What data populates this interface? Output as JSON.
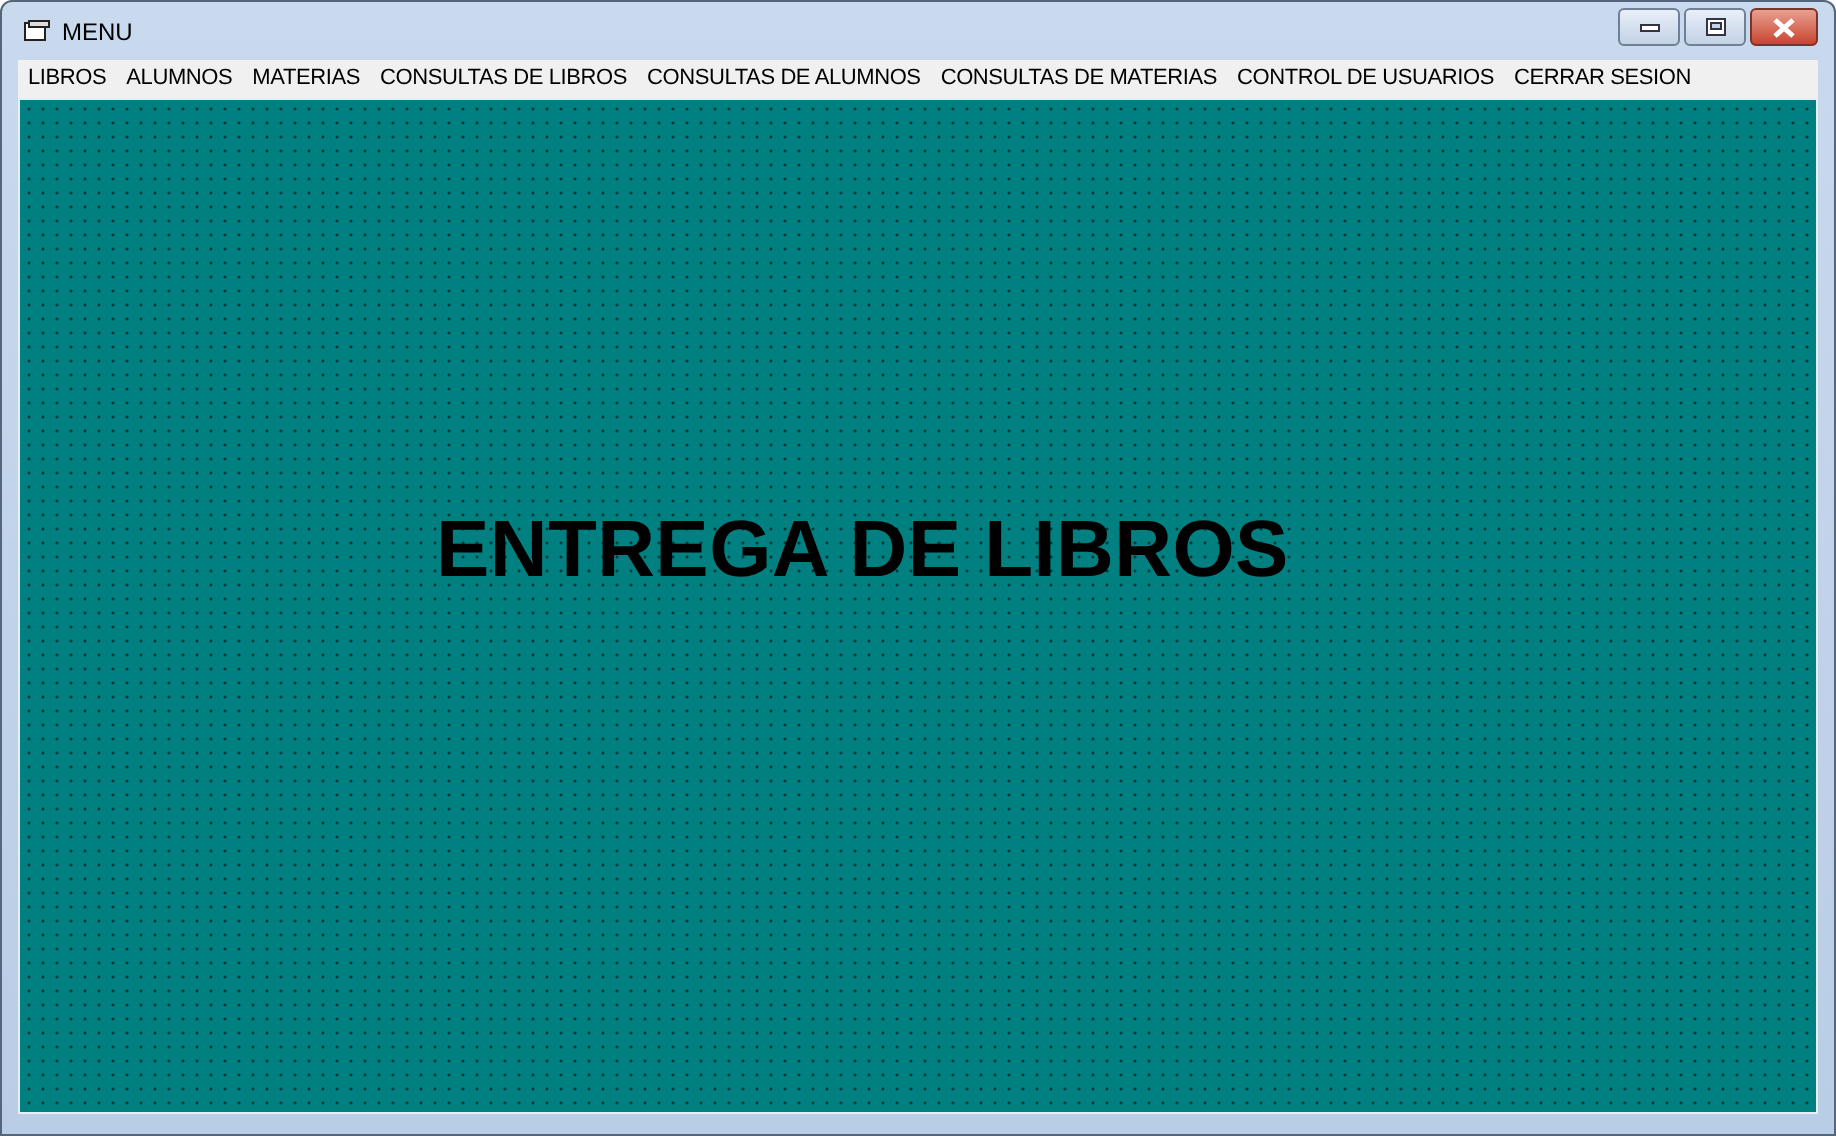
{
  "window": {
    "title": "MENU"
  },
  "menu": [
    "LIBROS",
    "ALUMNOS",
    "MATERIAS",
    "CONSULTAS DE LIBROS",
    "CONSULTAS DE ALUMNOS",
    "CONSULTAS DE MATERIAS",
    "CONTROL DE USUARIOS",
    "CERRAR SESION"
  ],
  "form": {
    "heading": "ENTREGA DE LIBROS"
  }
}
